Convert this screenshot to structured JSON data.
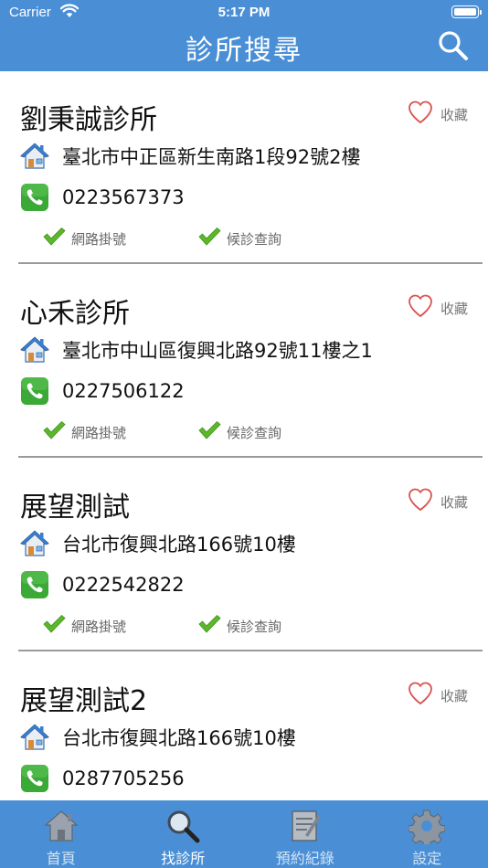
{
  "status_bar": {
    "carrier": "Carrier",
    "time": "5:17 PM"
  },
  "nav": {
    "title": "診所搜尋",
    "search_icon": "search-icon"
  },
  "clinics": [
    {
      "name": "劉秉誠診所",
      "favorite_label": "收藏",
      "address": "臺北市中正區新生南路1段92號2樓",
      "phone": "0223567373",
      "services": [
        "網路掛號",
        "候診查詢"
      ]
    },
    {
      "name": "心禾診所",
      "favorite_label": "收藏",
      "address": "臺北市中山區復興北路92號11樓之1",
      "phone": "0227506122",
      "services": [
        "網路掛號",
        "候診查詢"
      ]
    },
    {
      "name": "展望測試",
      "favorite_label": "收藏",
      "address": "台北市復興北路166號10樓",
      "phone": "0222542822",
      "services": [
        "網路掛號",
        "候診查詢"
      ]
    },
    {
      "name": "展望測試2",
      "favorite_label": "收藏",
      "address": "台北市復興北路166號10樓",
      "phone": "0287705256",
      "services": []
    }
  ],
  "tabbar": {
    "tabs": [
      {
        "label": "首頁",
        "icon": "home-icon",
        "active": false
      },
      {
        "label": "找診所",
        "icon": "magnifier-icon",
        "active": true
      },
      {
        "label": "預約紀錄",
        "icon": "notepad-icon",
        "active": false
      },
      {
        "label": "設定",
        "icon": "gear-icon",
        "active": false
      }
    ]
  },
  "colors": {
    "bar": "#4a8fd6",
    "heart": "#d9534f",
    "phone_green": "#3aa935",
    "check_green": "#5cb82a"
  }
}
